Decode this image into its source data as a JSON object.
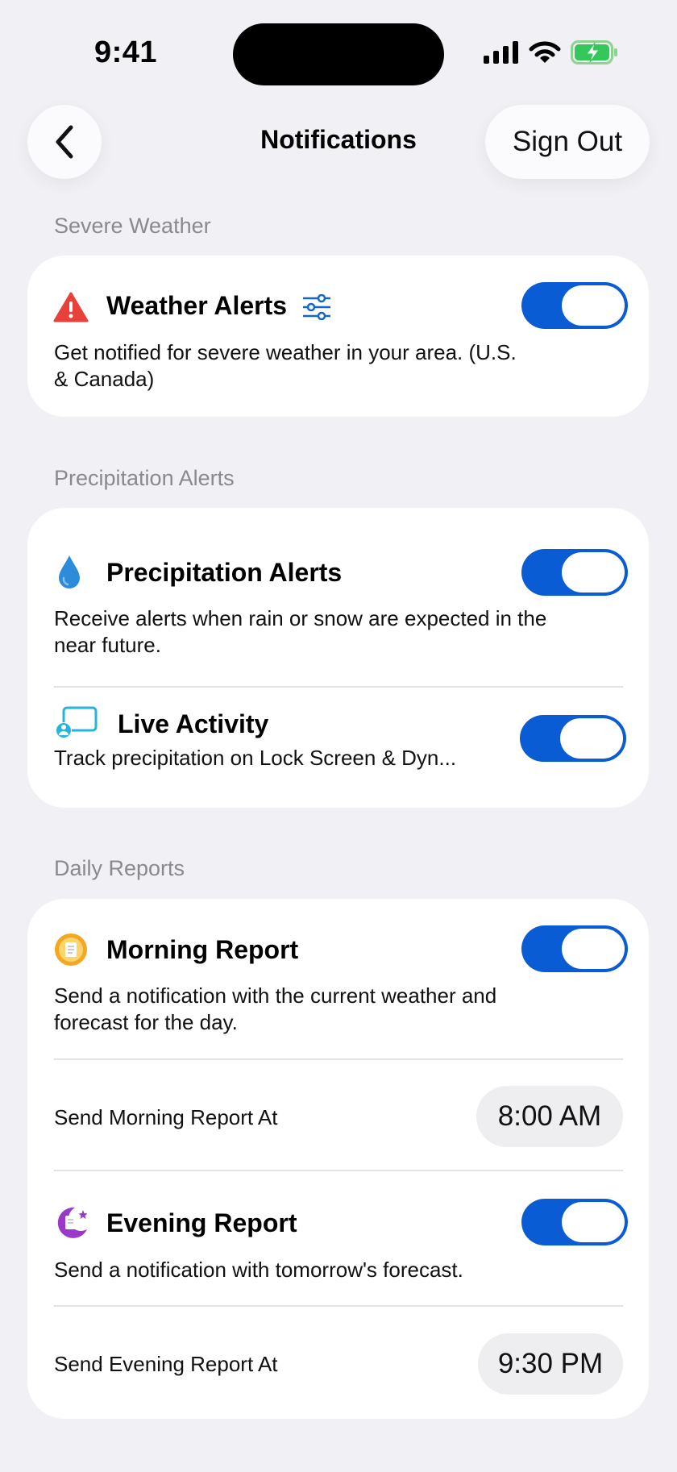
{
  "status": {
    "time": "9:41"
  },
  "nav": {
    "title": "Notifications",
    "sign_out": "Sign Out"
  },
  "sections": {
    "severe": {
      "label": "Severe Weather",
      "weather_alerts": {
        "title": "Weather Alerts",
        "desc_line1": "Get notified for severe weather in your area. (U.S.",
        "desc_line2": "& Canada)",
        "enabled": true
      }
    },
    "precip": {
      "label": "Precipitation Alerts",
      "precip_alerts": {
        "title": "Precipitation Alerts",
        "desc_line1": "Receive alerts when rain or snow are expected in the",
        "desc_line2": "near future.",
        "enabled": true
      },
      "live_activity": {
        "title": "Live Activity",
        "desc": "Track precipitation on Lock Screen & Dyn...",
        "enabled": true
      }
    },
    "daily": {
      "label": "Daily Reports",
      "morning": {
        "title": "Morning Report",
        "desc_line1": "Send a notification with the current weather and",
        "desc_line2": "forecast for the day.",
        "enabled": true,
        "time_label": "Send Morning Report At",
        "time_value": "8:00 AM"
      },
      "evening": {
        "title": "Evening Report",
        "desc": "Send a notification with tomorrow's forecast.",
        "enabled": true,
        "time_label": "Send Evening Report At",
        "time_value": "9:30 PM"
      }
    }
  },
  "colors": {
    "background": "#F0F0F5",
    "toggle_on": "#0A5CD5",
    "alert_red": "#E8403A",
    "accent_blue": "#1566C9"
  }
}
